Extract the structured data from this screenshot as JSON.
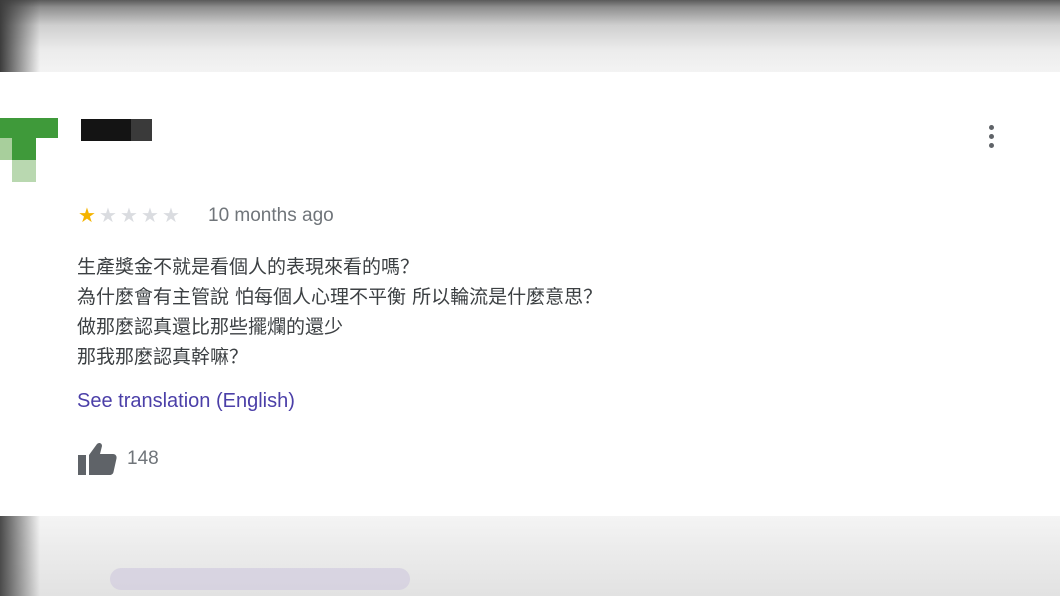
{
  "review": {
    "rating": 1,
    "max_rating": 5,
    "time_ago": "10 months ago",
    "text_lines": [
      "生產獎金不就是看個人的表現來看的嗎？",
      "為什麼會有主管說 怕每個人心理不平衡 所以輪流是什麼意思？",
      "做那麼認真還比那些擺爛的還少",
      "那我那麼認真幹嘛？"
    ],
    "translate_link": "See translation (English)",
    "like_count": "148"
  },
  "icons": {
    "more": "more-vert-icon",
    "like": "thumb-up-icon",
    "star": "star-icon"
  },
  "colors": {
    "star_on": "#f5b400",
    "star_off": "#dadce0",
    "link": "#4b3fa8",
    "text": "#3c4043",
    "muted": "#70757a"
  }
}
